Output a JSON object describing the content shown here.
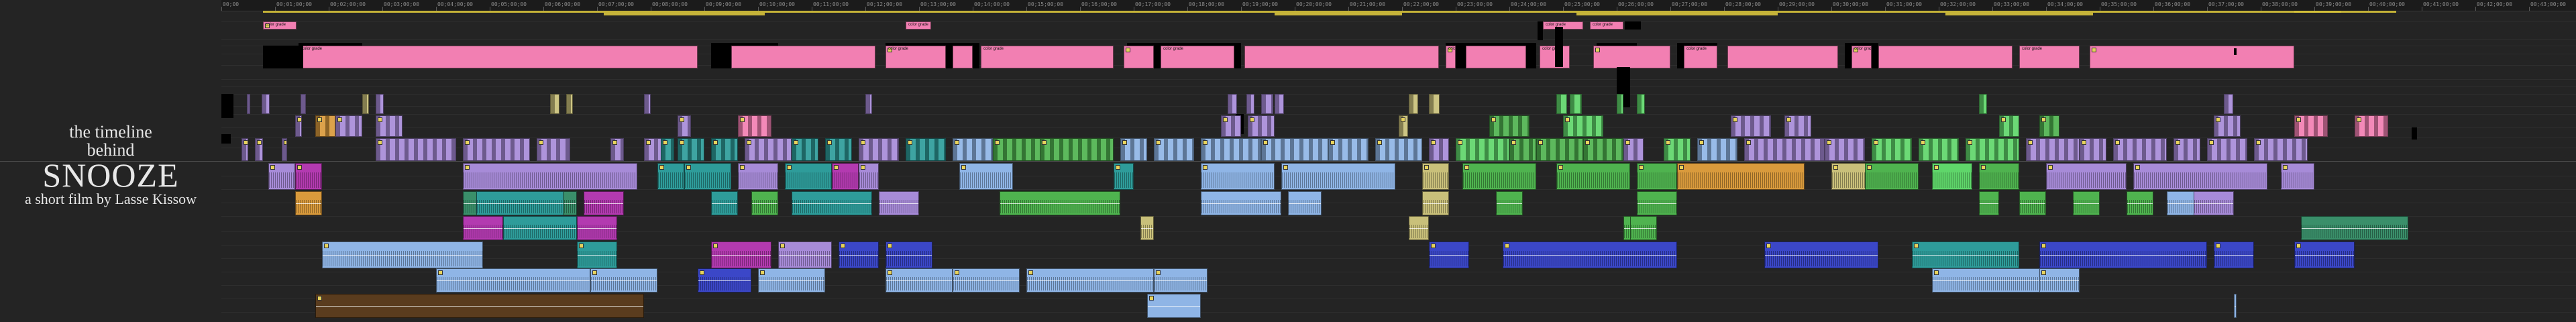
{
  "heading": {
    "line1": "the timeline",
    "line2": "behind",
    "title": "SNOOZE",
    "byline": "a short film by Lasse Kissow"
  },
  "ruler": {
    "labels": [
      "00;00",
      "00;01;00;00",
      "00;02;00;00",
      "00;03;00;00",
      "00;04;00;00",
      "00;05;00;00",
      "00;06;00;00",
      "00;07;00;00",
      "00;08;00;00",
      "00;09;00;00",
      "00;10;00;00",
      "00;11;00;00",
      "00;12;00;00",
      "00;13;00;00",
      "00;14;00;00",
      "00;15;00;00",
      "00;16;00;00",
      "00;17;00;00",
      "00;18;00;00",
      "00;19;00;00",
      "00;20;00;00",
      "00;21;00;00",
      "00;22;00;00",
      "00;23;00;00",
      "00;24;00;00",
      "00;25;00;00",
      "00;26;00;00",
      "00;27;00;00",
      "00;28;00;00",
      "00;29;00;00",
      "00;30;00;00",
      "00;31;00;00",
      "00;32;00;00",
      "00;33;00;00",
      "00;34;00;00",
      "00;35;00;00",
      "00;36;00;00",
      "00;37;00;00",
      "00;38;00;00",
      "00;39;00;00",
      "00;40;00;00",
      "00;41;00;00",
      "00;42;00;00",
      "00;43;00;00",
      "00;44;00;00",
      "00;45;00;00"
    ]
  },
  "colors": {
    "pink": "#f27fb2",
    "violet": "#a78bd8",
    "teal": "#2e9c9a",
    "green": "#4fb34f",
    "blue": "#8fb5e6",
    "indigo": "#3b47c8",
    "orange": "#d99a3c",
    "magenta": "#b33ab0",
    "khaki": "#c9c07a",
    "brown": "#5a3c1e",
    "lightgreen": "#5fd66a",
    "sea": "#3a8f6a"
  },
  "clip_labels": {
    "color_grade": "color grade",
    "nest": "Nested Sequence"
  }
}
